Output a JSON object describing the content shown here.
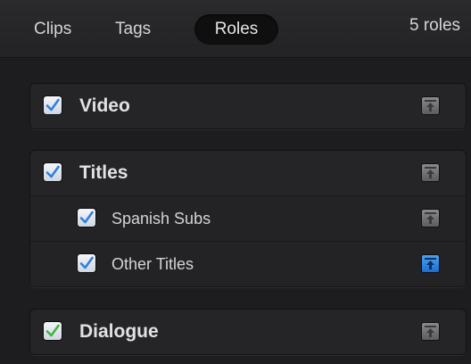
{
  "tabs": {
    "clips": "Clips",
    "tags": "Tags",
    "roles": "Roles"
  },
  "role_count": "5 roles",
  "roles": {
    "video": {
      "label": "Video",
      "checked": true,
      "check_color": "#2f7fe0"
    },
    "titles": {
      "label": "Titles",
      "checked": true,
      "check_color": "#2f7fe0",
      "subroles": [
        {
          "label": "Spanish Subs",
          "checked": true,
          "check_color": "#2f7fe0",
          "lane_active": false
        },
        {
          "label": "Other Titles",
          "checked": true,
          "check_color": "#2f7fe0",
          "lane_active": true
        }
      ]
    },
    "dialogue": {
      "label": "Dialogue",
      "checked": true,
      "check_color": "#3fb53f"
    }
  },
  "icons": {
    "checkbox": "checkmark-icon",
    "lane_button": "role-lane-icon"
  },
  "colors": {
    "accent_blue": "#2f7fe0",
    "accent_green": "#3fb53f",
    "lane_active": "#1d6fd1"
  }
}
